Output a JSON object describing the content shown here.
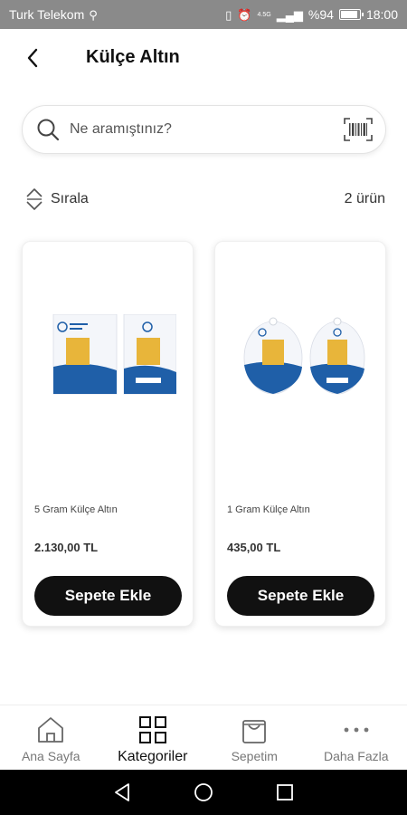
{
  "status_bar": {
    "carrier": "Turk Telekom",
    "battery_text": "%94",
    "time": "18:00",
    "battery_level": 0.94,
    "network_label": "4.5G"
  },
  "header": {
    "title": "Külçe Altın"
  },
  "search": {
    "placeholder": "Ne aramıştınız?"
  },
  "sort": {
    "label": "Sırala",
    "count": "2 ürün"
  },
  "products": [
    {
      "name": "5 Gram Külçe Altın",
      "price": "2.130,00 TL",
      "button_label": "Sepete Ekle"
    },
    {
      "name": "1 Gram Külçe Altın",
      "price": "435,00 TL",
      "button_label": "Sepete Ekle"
    }
  ],
  "bottom_nav": {
    "items": [
      {
        "label": "Ana Sayfa",
        "icon": "home-icon"
      },
      {
        "label": "Kategoriler",
        "icon": "grid-icon",
        "active": true
      },
      {
        "label": "Sepetim",
        "icon": "shopping-bag-icon"
      },
      {
        "label": "Daha Fazla",
        "icon": "more-dots-icon"
      }
    ]
  },
  "colors": {
    "status_bar": "#8a8a8a",
    "primary_button": "#111111",
    "card_blue": "#1f5fa8",
    "gold": "#e8b53a"
  }
}
